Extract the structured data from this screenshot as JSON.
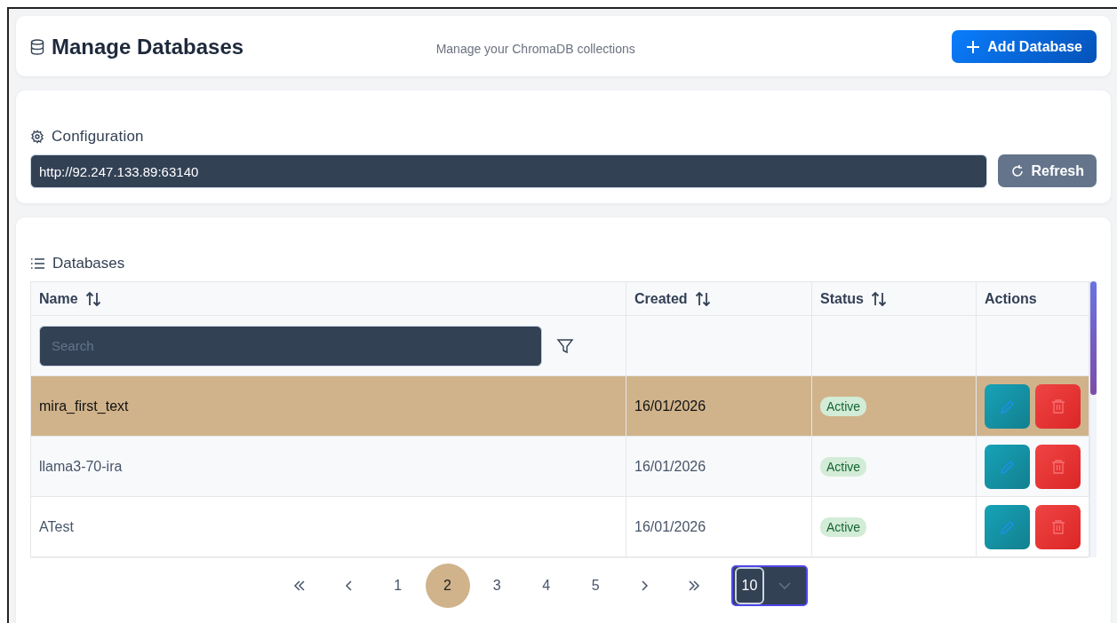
{
  "header": {
    "title": "Manage Databases",
    "subtitle": "Manage your ChromaDB collections",
    "add_button": "Add Database"
  },
  "configuration": {
    "title": "Configuration",
    "url": "http://92.247.133.89:63140",
    "refresh_button": "Refresh"
  },
  "databases": {
    "title": "Databases",
    "columns": [
      {
        "label": "Name",
        "sortable": true
      },
      {
        "label": "Created",
        "sortable": true
      },
      {
        "label": "Status",
        "sortable": true
      },
      {
        "label": "Actions",
        "sortable": false
      }
    ],
    "search": {
      "placeholder": "Search"
    },
    "rows": [
      {
        "name": "mira_first_text",
        "created": "16/01/2026",
        "status": "Active",
        "selected": true
      },
      {
        "name": "llama3-70-ira",
        "created": "16/01/2026",
        "status": "Active",
        "selected": false
      },
      {
        "name": "ATest",
        "created": "16/01/2026",
        "status": "Active",
        "selected": false
      }
    ],
    "pagination": {
      "pages": [
        {
          "label": "1",
          "selected": false
        },
        {
          "label": "2",
          "selected": true
        },
        {
          "label": "3",
          "selected": false
        },
        {
          "label": "4",
          "selected": false
        },
        {
          "label": "5",
          "selected": false
        }
      ],
      "rows_per_page": "10"
    }
  }
}
